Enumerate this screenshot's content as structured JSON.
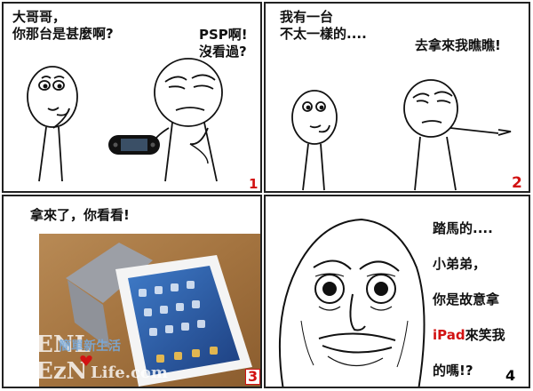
{
  "panels": [
    {
      "number": "1",
      "bubbles": [
        "大哥哥，\n你那台是甚麼啊?",
        "PSP啊!\n沒看過?"
      ]
    },
    {
      "number": "2",
      "bubbles": [
        "我有一台\n不太一樣的....",
        "去拿來我瞧瞧!"
      ]
    },
    {
      "number": "3",
      "bubbles": [
        "拿來了，你看看!"
      ],
      "watermark": {
        "line1": "ENL",
        "line2": "EzN",
        "tagline": "簡單新生活",
        "site": "Life.com"
      }
    },
    {
      "number": "4",
      "bubble_lines": [
        "踏馬的....",
        "小弟弟，",
        "你是故意拿"
      ],
      "bubble_ipad": "iPad",
      "bubble_after_ipad": "來笑我",
      "bubble_last": "的嗎!?"
    }
  ],
  "colors": {
    "number_red": "#d21212",
    "ink": "#111111",
    "border": "#222222"
  }
}
